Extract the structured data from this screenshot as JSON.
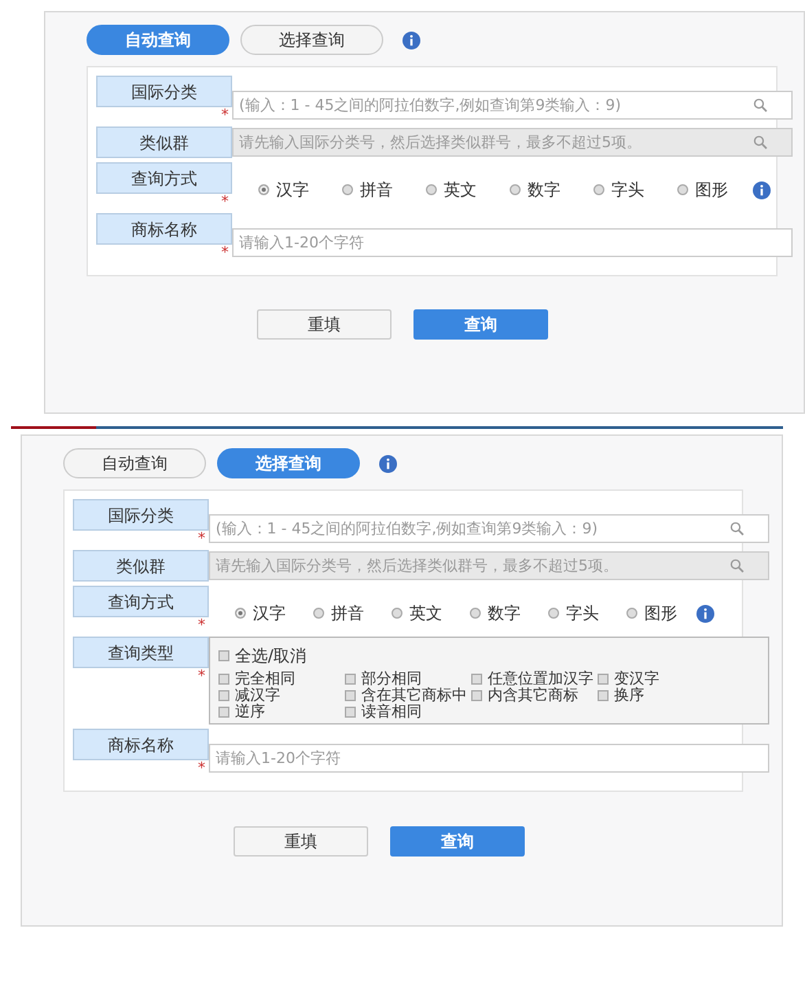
{
  "panels": [
    {
      "tabs": [
        {
          "label": "自动查询",
          "selected": true
        },
        {
          "label": "选择查询",
          "selected": false
        }
      ],
      "rows": [
        {
          "kind": "field",
          "label": "国际分类",
          "asterisk": "*",
          "placeholder": "(输入：1 - 45之间的阿拉伯数字,例如查询第9类输入：9)",
          "disabled": false,
          "search": true
        },
        {
          "kind": "field",
          "label": "类似群",
          "placeholder": "请先输入国际分类号，然后选择类似群号，最多不超过5项。",
          "disabled": true,
          "search": true
        },
        {
          "kind": "radio",
          "label": "查询方式",
          "asterisk": "*",
          "options": [
            {
              "label": "汉字",
              "selected": true
            },
            {
              "label": "拼音",
              "selected": false
            },
            {
              "label": "英文",
              "selected": false
            },
            {
              "label": "数字",
              "selected": false
            },
            {
              "label": "字头",
              "selected": false
            },
            {
              "label": "图形",
              "selected": false
            }
          ]
        },
        {
          "kind": "field",
          "label": "商标名称",
          "asterisk": "*",
          "placeholder": "请输入1-20个字符",
          "disabled": false,
          "search": false
        }
      ],
      "buttons": [
        {
          "label": "重填",
          "kind": "secondary"
        },
        {
          "label": "查询",
          "kind": "primary"
        }
      ]
    },
    {
      "tabs": [
        {
          "label": "自动查询",
          "selected": false
        },
        {
          "label": "选择查询",
          "selected": true
        }
      ],
      "rows": [
        {
          "kind": "field",
          "label": "国际分类",
          "asterisk": "*",
          "placeholder": "(输入：1 - 45之间的阿拉伯数字,例如查询第9类输入：9)",
          "disabled": false,
          "search": true
        },
        {
          "kind": "field",
          "label": "类似群",
          "placeholder": "请先输入国际分类号，然后选择类似群号，最多不超过5项。",
          "disabled": true,
          "search": true
        },
        {
          "kind": "radio",
          "label": "查询方式",
          "asterisk": "*",
          "options": [
            {
              "label": "汉字",
              "selected": true
            },
            {
              "label": "拼音",
              "selected": false
            },
            {
              "label": "英文",
              "selected": false
            },
            {
              "label": "数字",
              "selected": false
            },
            {
              "label": "字头",
              "selected": false
            },
            {
              "label": "图形",
              "selected": false
            }
          ]
        },
        {
          "kind": "checks",
          "label": "查询类型",
          "asterisk": "*",
          "select_all": {
            "label": "全选/取消",
            "checked": false
          },
          "options": [
            {
              "label": "完全相同",
              "checked": false
            },
            {
              "label": "部分相同",
              "checked": false
            },
            {
              "label": "任意位置加汉字",
              "checked": false
            },
            {
              "label": "变汉字",
              "checked": false
            },
            {
              "label": "减汉字",
              "checked": false
            },
            {
              "label": "含在其它商标中",
              "checked": false
            },
            {
              "label": "内含其它商标",
              "checked": false
            },
            {
              "label": "换序",
              "checked": false
            },
            {
              "label": "逆序",
              "checked": false
            },
            {
              "label": "读音相同",
              "checked": false
            }
          ]
        },
        {
          "kind": "field",
          "label": "商标名称",
          "asterisk": "*",
          "placeholder": "请输入1-20个字符",
          "disabled": false,
          "search": false
        }
      ],
      "buttons": [
        {
          "label": "重填",
          "kind": "secondary"
        },
        {
          "label": "查询",
          "kind": "primary"
        }
      ]
    }
  ]
}
